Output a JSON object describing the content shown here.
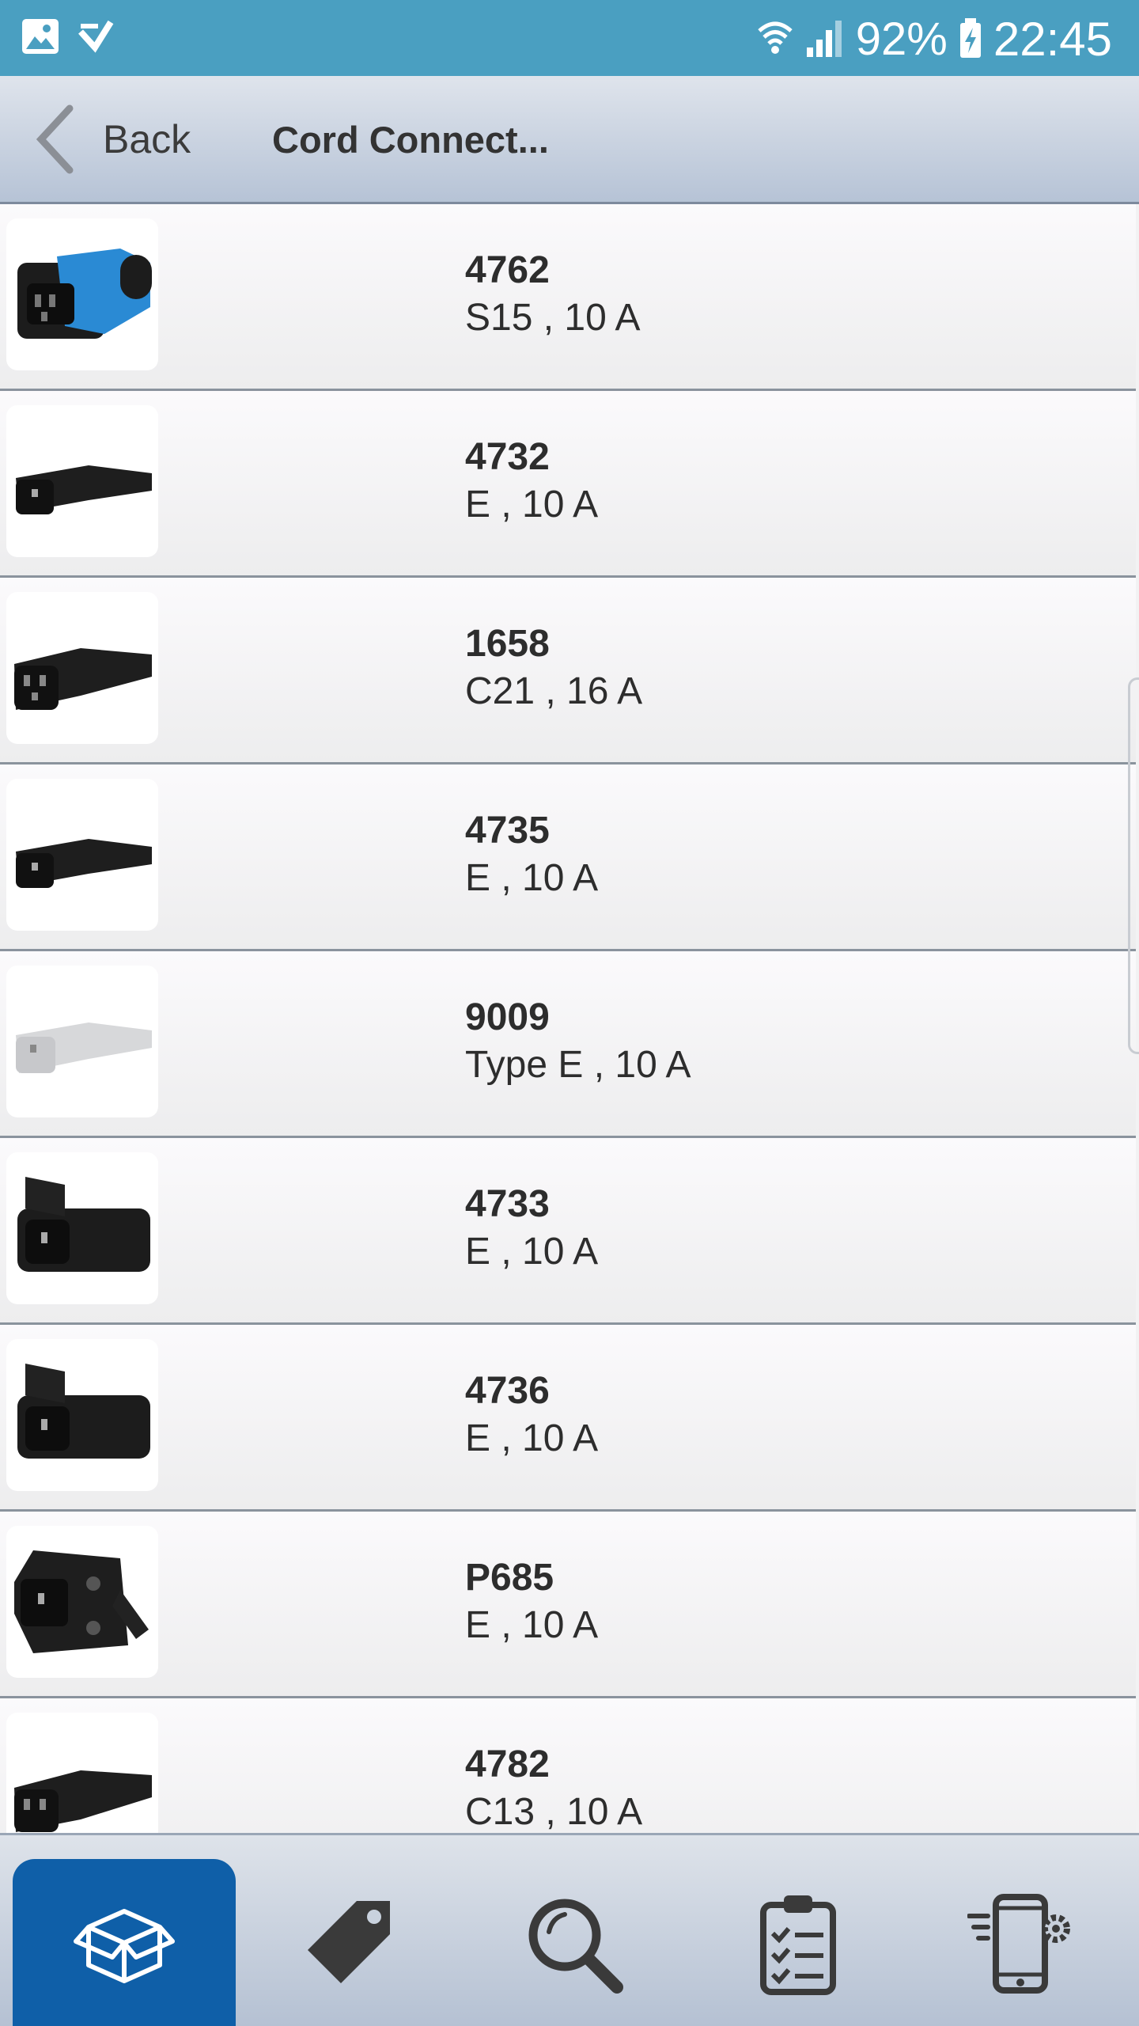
{
  "status_bar": {
    "battery": "92%",
    "time": "22:45",
    "icons": [
      "gallery-icon",
      "task-check-icon",
      "wifi-icon",
      "signal-icon",
      "battery-charging-icon"
    ]
  },
  "nav": {
    "back_label": "Back",
    "title": "Cord Connect..."
  },
  "products": [
    {
      "code": "4762",
      "spec": "S15 , 10 A",
      "thumb": "blue-black-connector"
    },
    {
      "code": "4732",
      "spec": "E , 10 A",
      "thumb": "black-inlet-plug"
    },
    {
      "code": "1658",
      "spec": "C21 , 16 A",
      "thumb": "black-connector"
    },
    {
      "code": "4735",
      "spec": "E , 10 A",
      "thumb": "black-inlet-plug"
    },
    {
      "code": "9009",
      "spec": "Type E , 10 A",
      "thumb": "white-inlet-plug"
    },
    {
      "code": "4733",
      "spec": "E , 10 A",
      "thumb": "black-angled-plug"
    },
    {
      "code": "4736",
      "spec": "E , 10 A",
      "thumb": "black-angled-plug"
    },
    {
      "code": "P685",
      "spec": "E , 10 A",
      "thumb": "black-panel-inlet"
    },
    {
      "code": "4782",
      "spec": "C13 , 10 A",
      "thumb": "black-connector"
    }
  ],
  "tabs": [
    {
      "name": "products",
      "icon": "box-icon",
      "active": true
    },
    {
      "name": "tags",
      "icon": "tag-icon",
      "active": false
    },
    {
      "name": "search",
      "icon": "search-icon",
      "active": false
    },
    {
      "name": "list",
      "icon": "clipboard-checklist-icon",
      "active": false
    },
    {
      "name": "settings",
      "icon": "phone-settings-icon",
      "active": false
    }
  ],
  "colors": {
    "status_bar": "#4a9fc1",
    "active_tab": "#0f5fa8",
    "accent_blue": "#2a8ad4"
  }
}
